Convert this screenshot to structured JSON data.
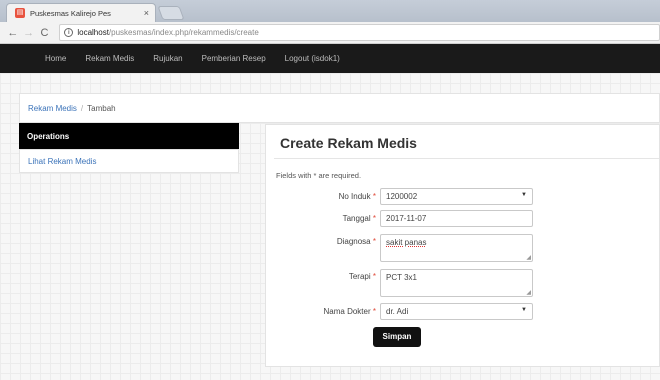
{
  "browser": {
    "tab_title": "Puskesmas Kalirejo Pes",
    "favicon": "puskesmas-favicon",
    "url_host": "localhost",
    "url_path": "/puskesmas/index.php/rekammedis/create"
  },
  "nav": {
    "items": [
      "Home",
      "Rekam Medis",
      "Rujukan",
      "Pemberian Resep",
      "Logout (isdok1)"
    ]
  },
  "breadcrumb": {
    "link": "Rekam Medis",
    "current": "Tambah"
  },
  "sidebar": {
    "heading": "Operations",
    "items": [
      "Lihat Rekam Medis"
    ]
  },
  "form": {
    "title": "Create Rekam Medis",
    "note": "Fields with * are required.",
    "fields": [
      {
        "label": "No Induk",
        "value": "1200002",
        "type": "select"
      },
      {
        "label": "Tanggal",
        "value": "2017-11-07",
        "type": "text"
      },
      {
        "label": "Diagnosa",
        "value": "sakit panas",
        "type": "textarea"
      },
      {
        "label": "Terapi",
        "value": "PCT 3x1",
        "type": "textarea"
      },
      {
        "label": "Nama Dokter",
        "value": "dr. Adi",
        "type": "select"
      }
    ],
    "required_mark": "*",
    "submit_label": "Simpan"
  },
  "colors": {
    "navbar": "#1a1a1a",
    "link": "#3b73b9",
    "required": "#e04a3a",
    "button": "#111111"
  }
}
